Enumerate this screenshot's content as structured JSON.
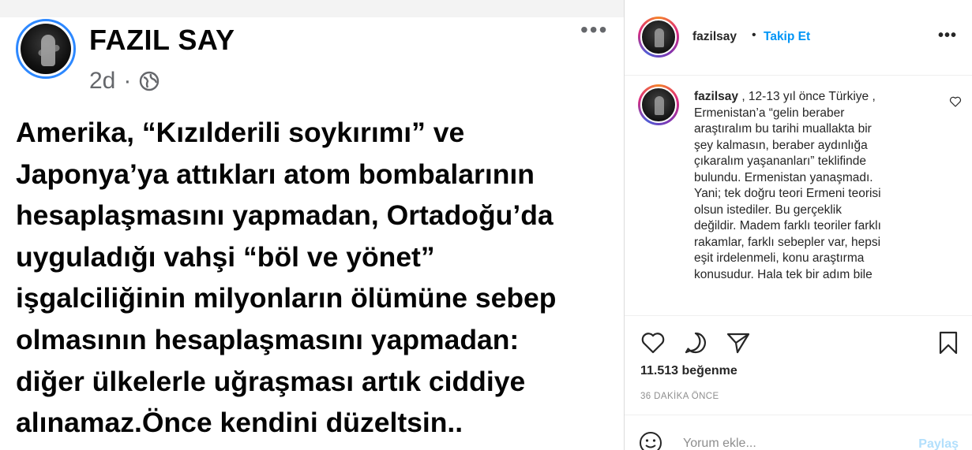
{
  "post_image": {
    "author": "FAZIL SAY",
    "time": "2d",
    "separator": "·",
    "more": "•••",
    "body_lines": [
      "Amerika,  “Kızılderili soykırımı” ve",
      "Japonya’ya attıkları atom bombalarının",
      "hesaplaşmasını yapmadan, Ortadoğu’da",
      "uyguladığı vahşi “böl ve yönet”",
      "işgalciliğinin milyonların ölümüne sebep",
      "olmasının hesaplaşmasını yapmadan:",
      "diğer ülkelerle uğraşması artık ciddiye",
      "alınamaz.Önce kendini düzeltsin.."
    ]
  },
  "header": {
    "username": "fazilsay",
    "dot": "•",
    "follow_label": "Takip Et",
    "more": "•••"
  },
  "caption": {
    "username": "fazilsay",
    "lines": [
      " , 12-13 yıl önce Türkiye ,",
      "Ermenistan’a “gelin beraber",
      "araştıralım bu tarihi muallakta bir",
      "şey kalmasın, beraber aydınlığa",
      "çıkaralım yaşananları” teklifinde",
      "bulundu. Ermenistan yanaşmadı.",
      "Yani; tek doğru teori Ermeni teorisi",
      "olsun istediler. Bu gerçeklik",
      "değildir. Madem farklı teoriler farklı",
      "rakamlar, farklı sebepler var, hepsi",
      "eşit irdelenmeli, konu araştırma",
      "konusudur. Hala tek bir adım bile"
    ]
  },
  "actions": {
    "likes": "11.513 beğenme",
    "time": "36 DAKİKA ÖNCE"
  },
  "comment": {
    "placeholder": "Yorum ekle...",
    "post_label": "Paylaş"
  },
  "colors": {
    "accent": "#0095f6",
    "post_disabled": "#b2dffc",
    "fb_ring": "#2d88ff"
  }
}
